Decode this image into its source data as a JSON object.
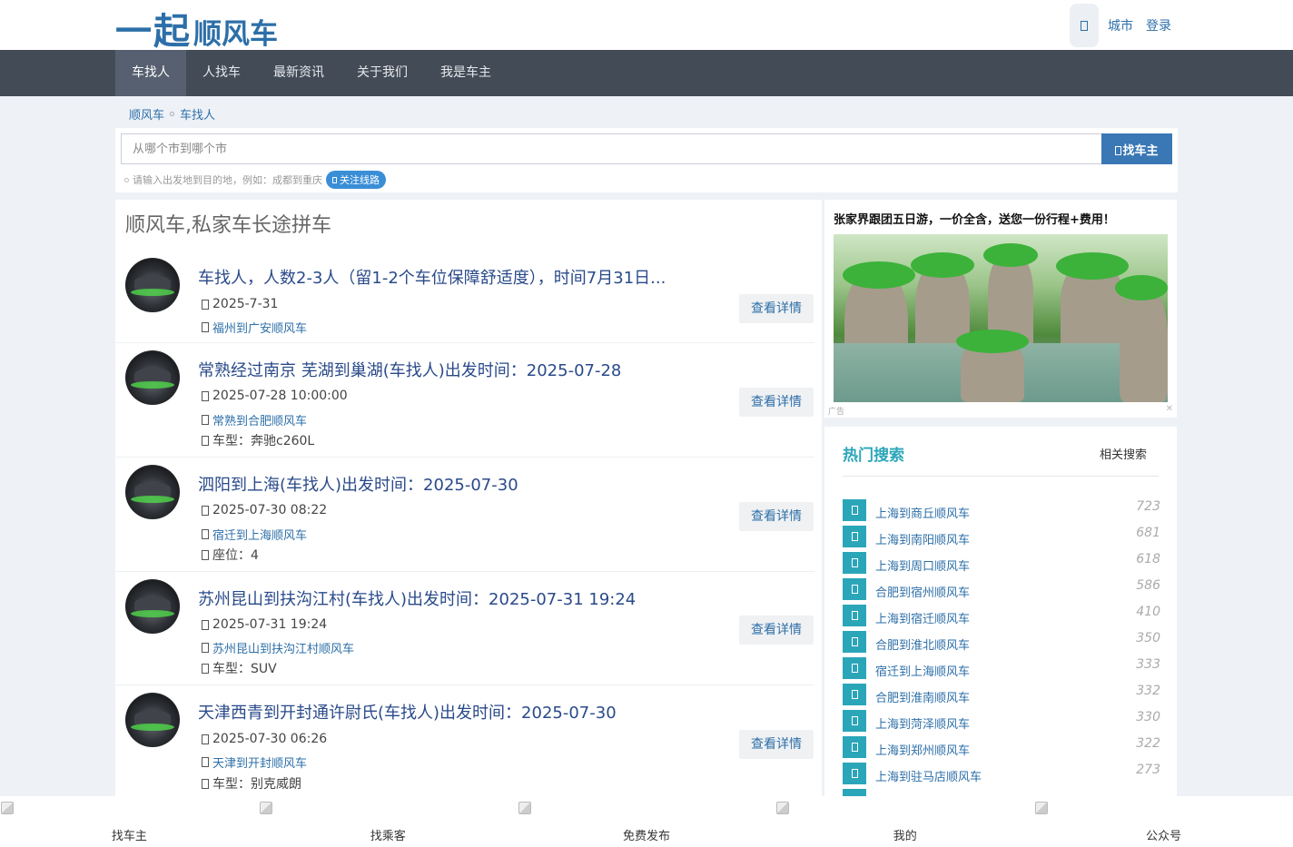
{
  "header": {
    "logo_big": "一起",
    "logo_small": "顺风车",
    "city_link": "城市",
    "login_link": "登录"
  },
  "nav": {
    "items": [
      "车找人",
      "人找车",
      "最新资讯",
      "关于我们",
      "我是车主"
    ],
    "active": "车找人"
  },
  "breadcrumb": [
    "顺风车",
    "车找人"
  ],
  "search": {
    "placeholder": "从哪个市到哪个市",
    "value": "",
    "button": "找车主",
    "hint": "请输入出发地到目的地，例如：成都到重庆",
    "follow": "关注线路"
  },
  "main": {
    "title": "顺风车,私家车长途拼车",
    "detail_label": "查看详情",
    "posts": [
      {
        "title": "车找人，人数2-3人（留1-2个车位保障舒适度），时间7月31日...",
        "time": "2025-7-31",
        "route": "福州到广安顺风车",
        "extra": ""
      },
      {
        "title": "常熟经过南京 芜湖到巢湖(车找人)出发时间：2025-07-28",
        "time": "2025-07-28 10:00:00",
        "route": "常熟到合肥顺风车",
        "extra": "车型：奔驰c260L"
      },
      {
        "title": "泗阳到上海(车找人)出发时间：2025-07-30",
        "time": "2025-07-30 08:22",
        "route": "宿迁到上海顺风车",
        "extra": "座位：4"
      },
      {
        "title": "苏州昆山到扶沟江村(车找人)出发时间：2025-07-31 19:24",
        "time": "2025-07-31 19:24",
        "route": "苏州昆山到扶沟江村顺风车",
        "extra": "车型：SUV"
      },
      {
        "title": "天津西青到开封通许尉氏(车找人)出发时间：2025-07-30",
        "time": "2025-07-30 06:26",
        "route": "天津到开封顺风车",
        "extra": "车型：别克威朗"
      }
    ]
  },
  "ad": {
    "title": "张家界跟团五日游，一价全含，送您一份行程+费用！",
    "label": "广告",
    "close": "✕"
  },
  "hot": {
    "title": "热门搜索",
    "related": "相关搜索",
    "items": [
      {
        "text": "上海到商丘顺风车",
        "count": "723"
      },
      {
        "text": "上海到南阳顺风车",
        "count": "681"
      },
      {
        "text": "上海到周口顺风车",
        "count": "618"
      },
      {
        "text": "合肥到宿州顺风车",
        "count": "586"
      },
      {
        "text": "上海到宿迁顺风车",
        "count": "410"
      },
      {
        "text": "合肥到淮北顺风车",
        "count": "350"
      },
      {
        "text": "宿迁到上海顺风车",
        "count": "333"
      },
      {
        "text": "合肥到淮南顺风车",
        "count": "332"
      },
      {
        "text": "上海到菏泽顺风车",
        "count": "330"
      },
      {
        "text": "上海到郑州顺风车",
        "count": "322"
      },
      {
        "text": "上海到驻马店顺风车",
        "count": "273"
      }
    ]
  },
  "tabbar": [
    "找车主",
    "找乘客",
    "免费发布",
    "我的",
    "公众号"
  ],
  "colors": {
    "brand": "#2d6fa8",
    "nav_bg": "#434b56",
    "accent_teal": "#2ba6b9",
    "button_blue": "#3a78b5"
  }
}
